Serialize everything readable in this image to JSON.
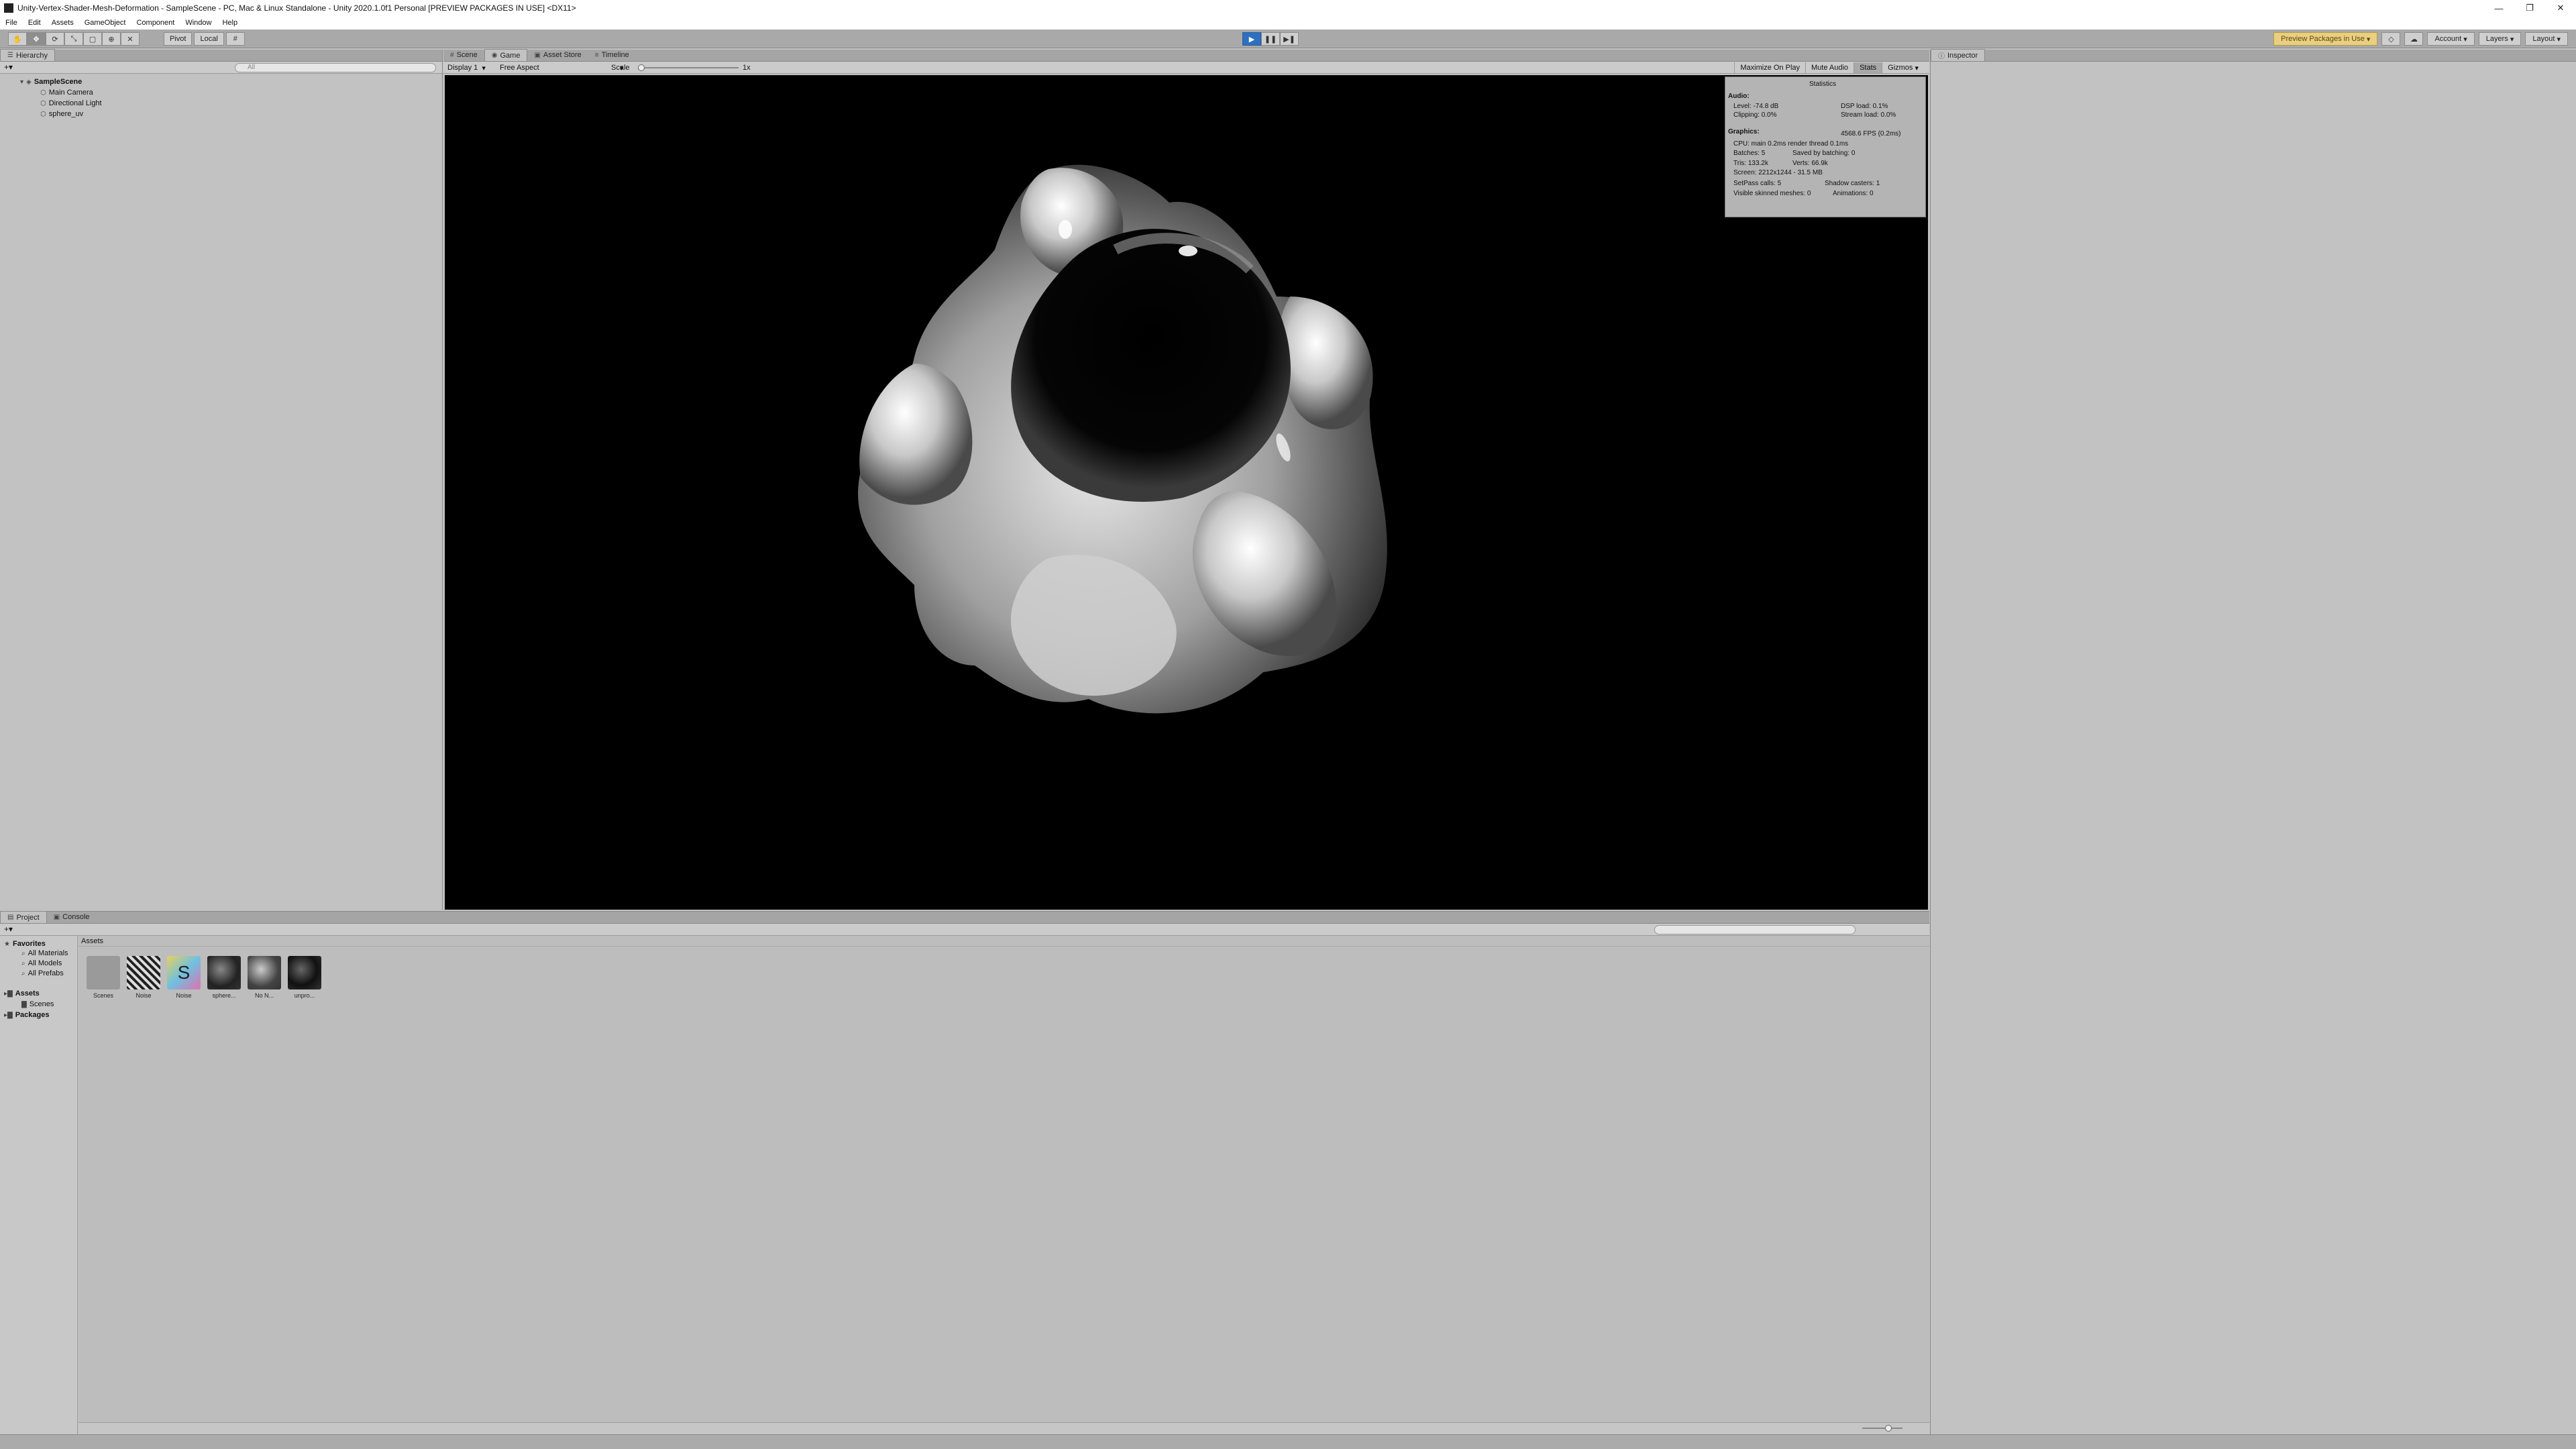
{
  "window": {
    "title": "Unity-Vertex-Shader-Mesh-Deformation - SampleScene - PC, Mac & Linux Standalone - Unity 2020.1.0f1 Personal [PREVIEW PACKAGES IN USE] <DX11>",
    "minimize": "—",
    "maximize": "❐",
    "close": "✕"
  },
  "menu": [
    "File",
    "Edit",
    "Assets",
    "GameObject",
    "Component",
    "Window",
    "Help"
  ],
  "toolbar": {
    "pivot": "Pivot",
    "local": "Local",
    "preview_packages": "Preview Packages in Use",
    "account": "Account",
    "layers": "Layers",
    "layout": "Layout"
  },
  "hierarchy": {
    "tab": "Hierarchy",
    "search_placeholder": "All",
    "scene": "SampleScene",
    "items": [
      "Main Camera",
      "Directional Light",
      "sphere_uv"
    ]
  },
  "center_tabs": [
    "Scene",
    "Game",
    "Asset Store",
    "Timeline"
  ],
  "game_toolbar": {
    "display": "Display 1",
    "aspect": "Free Aspect",
    "scale_label": "Scale",
    "scale_value": "1x",
    "maximize": "Maximize On Play",
    "mute": "Mute Audio",
    "stats": "Stats",
    "gizmos": "Gizmos"
  },
  "inspector": {
    "tab": "Inspector"
  },
  "statistics": {
    "title": "Statistics",
    "audio_header": "Audio:",
    "level": "Level: -74.8 dB",
    "clipping": "Clipping: 0.0%",
    "dsp_load": "DSP load: 0.1%",
    "stream_load": "Stream load: 0.0%",
    "graphics_header": "Graphics:",
    "fps": "4568.6 FPS (0.2ms)",
    "cpu": "CPU: main 0.2ms  render thread 0.1ms",
    "batches": "Batches: 5",
    "saved_batching": "Saved by batching: 0",
    "tris": "Tris: 133.2k",
    "verts": "Verts: 66.9k",
    "screen": "Screen: 2212x1244 - 31.5 MB",
    "setpass": "SetPass calls: 5",
    "shadow_casters": "Shadow casters: 1",
    "skinned": "Visible skinned meshes: 0",
    "animations": "Animations: 0"
  },
  "project": {
    "tabs": [
      "Project",
      "Console"
    ],
    "favorites_label": "Favorites",
    "favorites": [
      "All Materials",
      "All Models",
      "All Prefabs"
    ],
    "assets_label": "Assets",
    "asset_folders": [
      "Scenes"
    ],
    "packages_label": "Packages",
    "breadcrumb": "Assets",
    "items": [
      "Scenes",
      "Noise",
      "Noise",
      "sphere...",
      "No N...",
      "unpro..."
    ]
  }
}
